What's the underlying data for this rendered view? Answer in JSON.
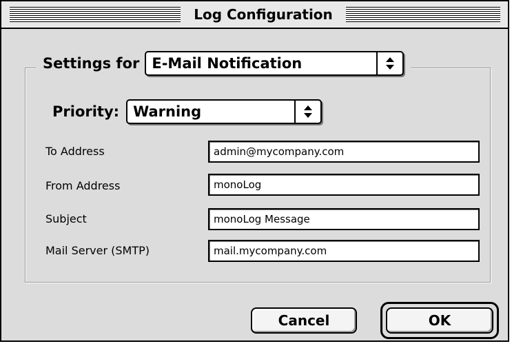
{
  "window": {
    "title": "Log Configuration"
  },
  "settings": {
    "label": "Settings for",
    "selected": "E-Mail Notification"
  },
  "priority": {
    "label": "Priority:",
    "selected": "Warning"
  },
  "fields": {
    "to": {
      "label": "To Address",
      "value": "admin@mycompany.com"
    },
    "from": {
      "label": "From Address",
      "value": "monoLog"
    },
    "subject": {
      "label": "Subject",
      "value": "monoLog Message"
    },
    "smtp": {
      "label": "Mail Server (SMTP)",
      "value": "mail.mycompany.com"
    }
  },
  "buttons": {
    "cancel": "Cancel",
    "ok": "OK"
  }
}
